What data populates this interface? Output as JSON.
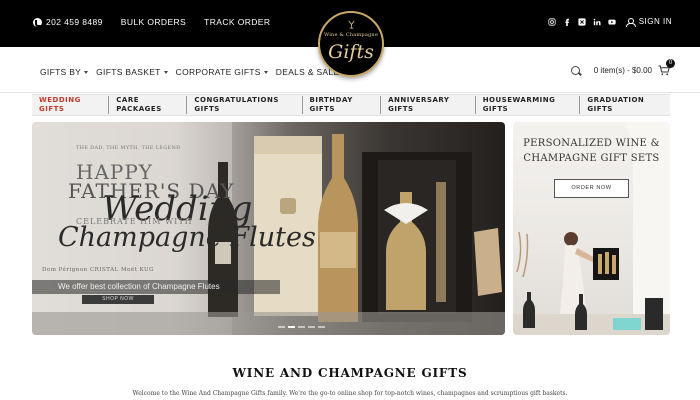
{
  "topbar": {
    "phone": "202 459 8489",
    "links": [
      "BULK ORDERS",
      "TRACK ORDER"
    ],
    "social_icons": [
      "instagram-icon",
      "facebook-icon",
      "x-icon",
      "linkedin-icon",
      "youtube-icon"
    ],
    "signin": "SIGN IN"
  },
  "logo": {
    "line1": "Wine & Champagne",
    "line2": "Gifts"
  },
  "nav": {
    "items": [
      {
        "label": "GIFTS BY",
        "dropdown": true
      },
      {
        "label": "GIFTS BASKET",
        "dropdown": true
      },
      {
        "label": "CORPORATE GIFTS",
        "dropdown": true
      },
      {
        "label": "DEALS & SALE",
        "dropdown": false
      }
    ],
    "cart_summary": "0 item(s) - $0.00",
    "cart_count": "0"
  },
  "categories": [
    {
      "label": "WEDDING GIFTS",
      "active": true
    },
    {
      "label": "CARE PACKAGES",
      "active": false
    },
    {
      "label": "CONGRATULATIONS GIFTS",
      "active": false
    },
    {
      "label": "BIRTHDAY GIFTS",
      "active": false
    },
    {
      "label": "ANNIVERSARY GIFTS",
      "active": false
    },
    {
      "label": "HOUSEWARMING GIFTS",
      "active": false
    },
    {
      "label": "GRADUATION GIFTS",
      "active": false
    }
  ],
  "hero": {
    "small_text": "THE DAD, THE MYTH, THE LEGEND",
    "happy": "HAPPY",
    "fathers": "FATHER'S DAY",
    "wedding": "Wedding",
    "celebrate": "CELEBRATE HIM WITH",
    "flutes": "Champagne Flutes",
    "brands": "Dom Pérignon   CRISTAL   Moët   KUG",
    "caption": "We offer best collection of Champagne Flutes",
    "shop_button": "SHOP NOW",
    "slides": 5,
    "active_slide": 2
  },
  "promo": {
    "title_line1": "PERSONALIZED WINE &",
    "title_line2": "CHAMPAGNE GIFT SETS",
    "button": "ORDER NOW"
  },
  "section": {
    "title": "WINE AND CHAMPAGNE GIFTS",
    "description": "Welcome to the Wine And Champagne Gifts family. We're the go-to online shop for top-notch wines, champagnes and scrumptious gift baskets."
  },
  "colors": {
    "topbar_bg": "#000000",
    "accent_gold": "#c9a86a",
    "active_category": "#c0392b"
  }
}
